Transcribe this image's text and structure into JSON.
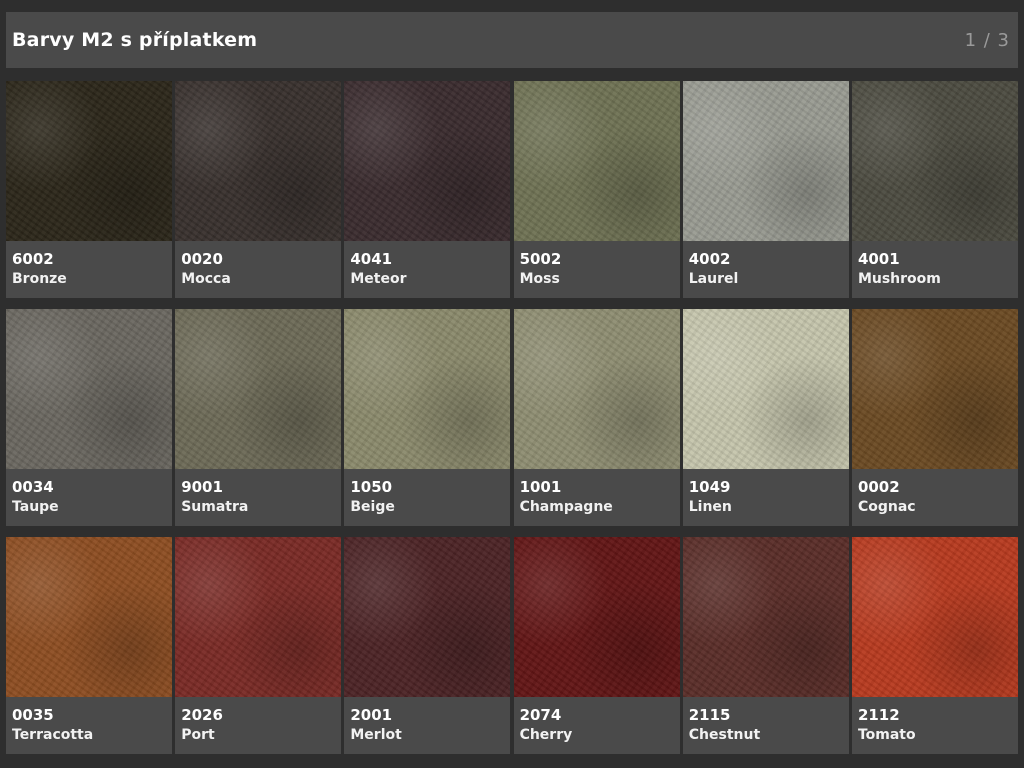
{
  "header": {
    "title": "Barvy M2 s příplatkem",
    "page_indicator": "1 / 3"
  },
  "swatches": [
    {
      "code": "6002",
      "name": "Bronze",
      "color": "#2b2619"
    },
    {
      "code": "0020",
      "name": "Mocca",
      "color": "#38302d"
    },
    {
      "code": "4041",
      "name": "Meteor",
      "color": "#3a2b2e"
    },
    {
      "code": "5002",
      "name": "Moss",
      "color": "#6f7254"
    },
    {
      "code": "4002",
      "name": "Laurel",
      "color": "#999b92"
    },
    {
      "code": "4001",
      "name": "Mushroom",
      "color": "#4c4b40"
    },
    {
      "code": "0034",
      "name": "Taupe",
      "color": "#6a6760"
    },
    {
      "code": "9001",
      "name": "Sumatra",
      "color": "#6d6a57"
    },
    {
      "code": "1050",
      "name": "Beige",
      "color": "#8b8a6c"
    },
    {
      "code": "1001",
      "name": "Champagne",
      "color": "#8f8e72"
    },
    {
      "code": "1049",
      "name": "Linen",
      "color": "#c5c5ac"
    },
    {
      "code": "0002",
      "name": "Cognac",
      "color": "#6b4a23"
    },
    {
      "code": "0035",
      "name": "Terracotta",
      "color": "#8e4e22"
    },
    {
      "code": "2026",
      "name": "Port",
      "color": "#7a2a25"
    },
    {
      "code": "2001",
      "name": "Merlot",
      "color": "#4c2325"
    },
    {
      "code": "2074",
      "name": "Cherry",
      "color": "#621515"
    },
    {
      "code": "2115",
      "name": "Chestnut",
      "color": "#5a2d28"
    },
    {
      "code": "2112",
      "name": "Tomato",
      "color": "#b83a1f"
    }
  ]
}
